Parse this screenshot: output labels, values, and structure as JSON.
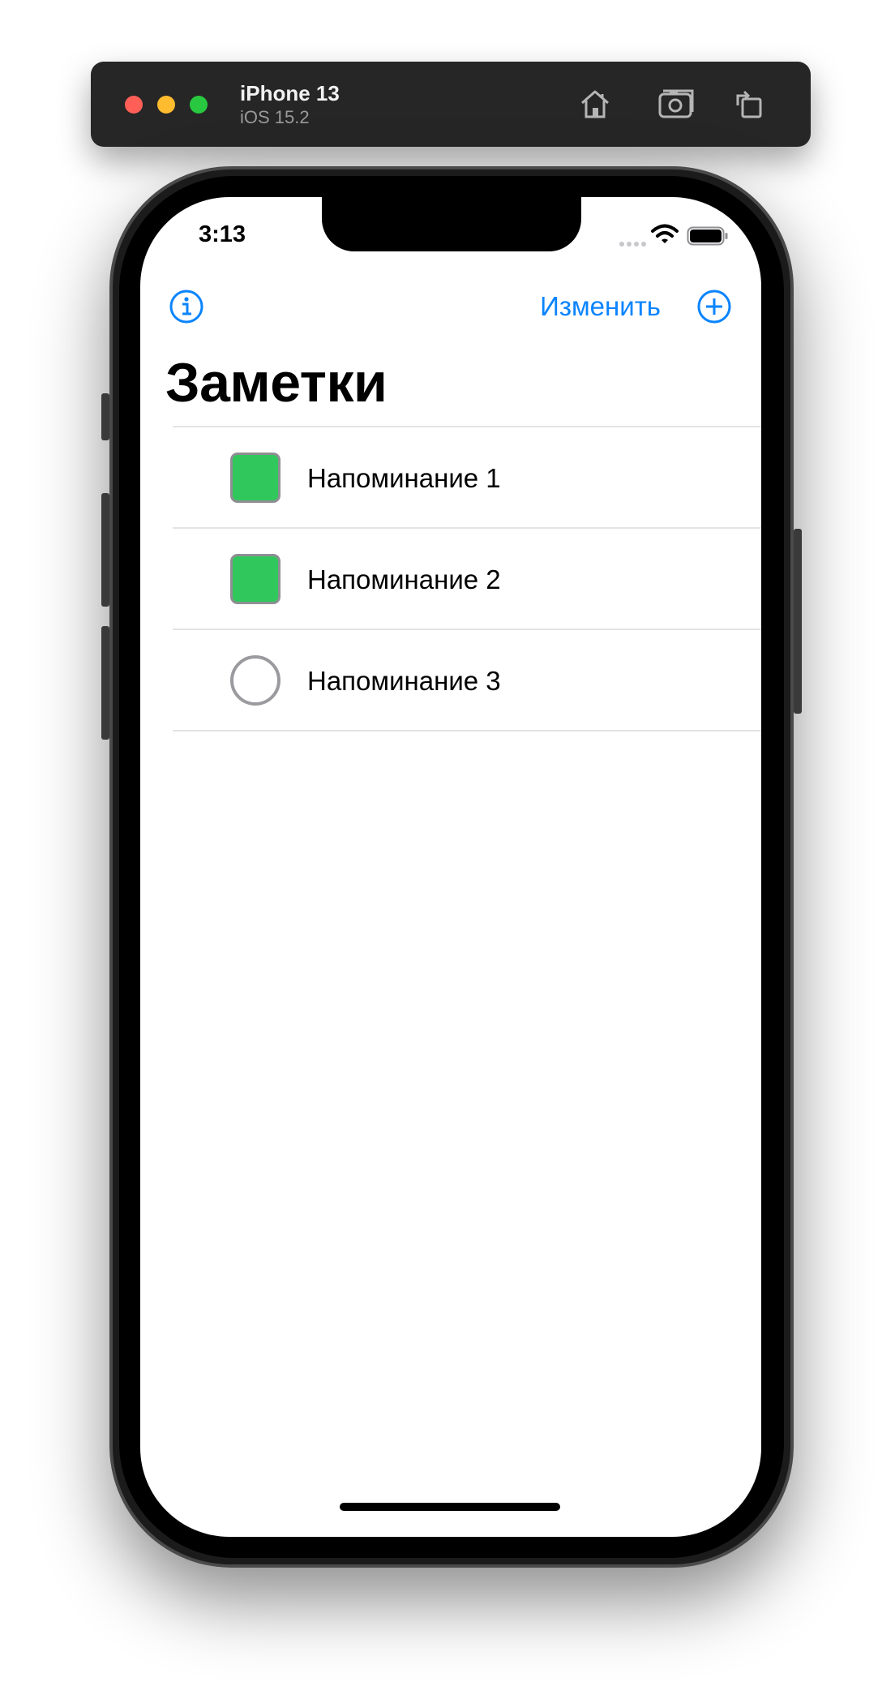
{
  "simulator": {
    "device_name": "iPhone 13",
    "os_version": "iOS 15.2",
    "icons": [
      "home-icon",
      "screenshot-icon",
      "rotate-icon"
    ]
  },
  "status_bar": {
    "time": "3:13",
    "icons": [
      "cellular-signal-icon",
      "wifi-icon",
      "battery-icon"
    ]
  },
  "nav": {
    "info_icon": "info-circle-icon",
    "edit_label": "Изменить",
    "add_icon": "plus-circle-icon",
    "title": "Заметки"
  },
  "reminders": [
    {
      "label": "Напоминание 1",
      "done": true
    },
    {
      "label": "Напоминание 2",
      "done": true
    },
    {
      "label": "Напоминание 3",
      "done": false
    }
  ],
  "colors": {
    "accent": "#0a84ff",
    "done_fill": "#30c85c",
    "checkbox_border": "#8e8e93"
  }
}
